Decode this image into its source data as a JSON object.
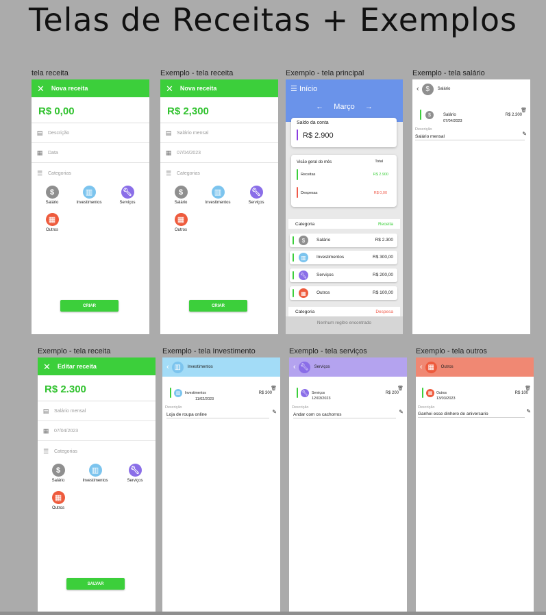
{
  "board_title": "Telas de Receitas + Exemplos",
  "frames": {
    "f1": "tela receita",
    "f2": "Exemplo - tela receita",
    "f3": "Exemplo - tela principal",
    "f4": "Exemplo - tela salário",
    "f5": "Exemplo - tela receita",
    "f6": "Exemplo - tela Investimento",
    "f7": "Exemplo - tela serviços",
    "f8": "Exemplo - tela outros"
  },
  "nova_receita": {
    "header": "Nova receita",
    "amount": "R$ 0,00",
    "descricao_placeholder": "Descrição",
    "data_placeholder": "Data",
    "categorias_label": "Categorias",
    "button": "CRIAR"
  },
  "exemplo_receita": {
    "header": "Nova receita",
    "amount": "R$ 2,300",
    "descricao": "Salário mensal",
    "data": "07/04/2023",
    "categorias_label": "Categorias",
    "button": "CRIAR"
  },
  "editar_receita": {
    "header": "Editar receita",
    "amount": "R$ 2.300",
    "descricao": "Salário mensal",
    "data": "07/04/2023",
    "categorias_label": "Categorias",
    "button": "SALVAR"
  },
  "categories": {
    "salario": "Salário",
    "investimentos": "Investimentos",
    "servicos": "Serviços",
    "outros": "Outros"
  },
  "principal": {
    "title": "Início",
    "month": "Março",
    "saldo_label": "Saldo da conta",
    "saldo_value": "R$ 2.900",
    "visao_title": "Visão geral do mês",
    "total_label": "Total",
    "receitas_label": "Receitas",
    "receitas_value": "R$ 2.900",
    "despesas_label": "Despesas",
    "despesas_value": "R$ 0,00",
    "categoria_label": "Categoria",
    "receita_col": "Receita",
    "rows": [
      {
        "label": "Salário",
        "value": "R$ 2.300"
      },
      {
        "label": "Investimentos",
        "value": "R$ 300,00"
      },
      {
        "label": "Serviços",
        "value": "R$ 200,00"
      },
      {
        "label": "Outros",
        "value": "R$ 100,00"
      }
    ],
    "categoria_label_2": "Categoria",
    "despesa_col": "Despesa",
    "empty": "Nenhum regitro encontrado"
  },
  "salario_screen": {
    "header": "Salário",
    "entry_label": "Salário",
    "entry_date": "07/04/2023",
    "entry_value": "R$ 2.300",
    "desc_label": "Descrição",
    "desc": "Salário mensal"
  },
  "investimento_screen": {
    "header": "Investimentos",
    "entry_label": "Investimentos",
    "entry_date": "11/02/2023",
    "entry_value": "R$ 300",
    "desc_label": "Descrição",
    "desc": "Loja de roupa  online"
  },
  "servicos_screen": {
    "header": "Serviços",
    "entry_label": "Serviços",
    "entry_date": "12/03/2023",
    "entry_value": "R$ 200",
    "desc_label": "Descrição",
    "desc": "Andar com os cachorros"
  },
  "outros_screen": {
    "header": "Outros",
    "entry_label": "Outros",
    "entry_date": "13/03/2023",
    "entry_value": "R$ 100",
    "desc_label": "Descrição",
    "desc": "Ganhei esse dinhero de aniversario"
  },
  "colors": {
    "green": "#3ccf3b",
    "blue_header": "#6a93ea",
    "invest_header": "#a3dcf7",
    "servicos_header": "#b4a3ef",
    "outros_header": "#f08873",
    "despesa_red": "#ef5a4a"
  }
}
